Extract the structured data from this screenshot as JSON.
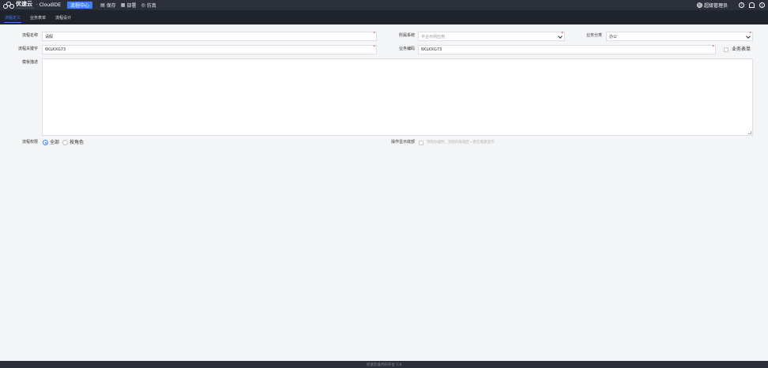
{
  "header": {
    "logo_name": "优速云",
    "logo_sub": "YOUSUCLOUD",
    "logo_product": "· CloudIDE",
    "center_badge": "流程中心",
    "actions": [
      {
        "label": "保存",
        "icon": "save-icon"
      },
      {
        "label": "部署",
        "icon": "deploy-icon"
      },
      {
        "label": "仿真",
        "icon": "simulate-icon"
      }
    ],
    "user_avatar": "超",
    "user_name": "超级管理员",
    "right_icons": [
      "help-icon",
      "home-icon",
      "power-icon"
    ]
  },
  "tabs": [
    {
      "label": "流程定义",
      "active": true
    },
    {
      "label": "业务表单",
      "active": false
    },
    {
      "label": "流程设计",
      "active": false
    }
  ],
  "form": {
    "process_name": {
      "label": "流程名称",
      "value": "请假"
    },
    "system": {
      "label": "所属系统",
      "value": "平台示例应用"
    },
    "business_category": {
      "label": "业务分类",
      "value": "办公"
    },
    "process_key": {
      "label": "流程关键字",
      "value": "6KLKXG73"
    },
    "business_code": {
      "label": "业务编码",
      "value": "6KLKXG73"
    },
    "business_form": {
      "label": "业务表单",
      "checked": false
    },
    "template_desc": {
      "label": "模板描述",
      "value": ""
    },
    "permission": {
      "label": "流程权限",
      "options": [
        {
          "label": "全部",
          "selected": true
        },
        {
          "label": "按角色",
          "selected": false
        }
      ]
    },
    "op_display": {
      "label": "操作显示底部",
      "hint": "流程办理时，流程的处理区一直在底部显示",
      "checked": false
    }
  },
  "footer": {
    "text": "优速云低代码平台 5.0"
  },
  "colors": {
    "accent": "#3d7fff",
    "topbar": "#2b2f3a",
    "tabbar": "#1f232b",
    "required": "#e02020"
  }
}
